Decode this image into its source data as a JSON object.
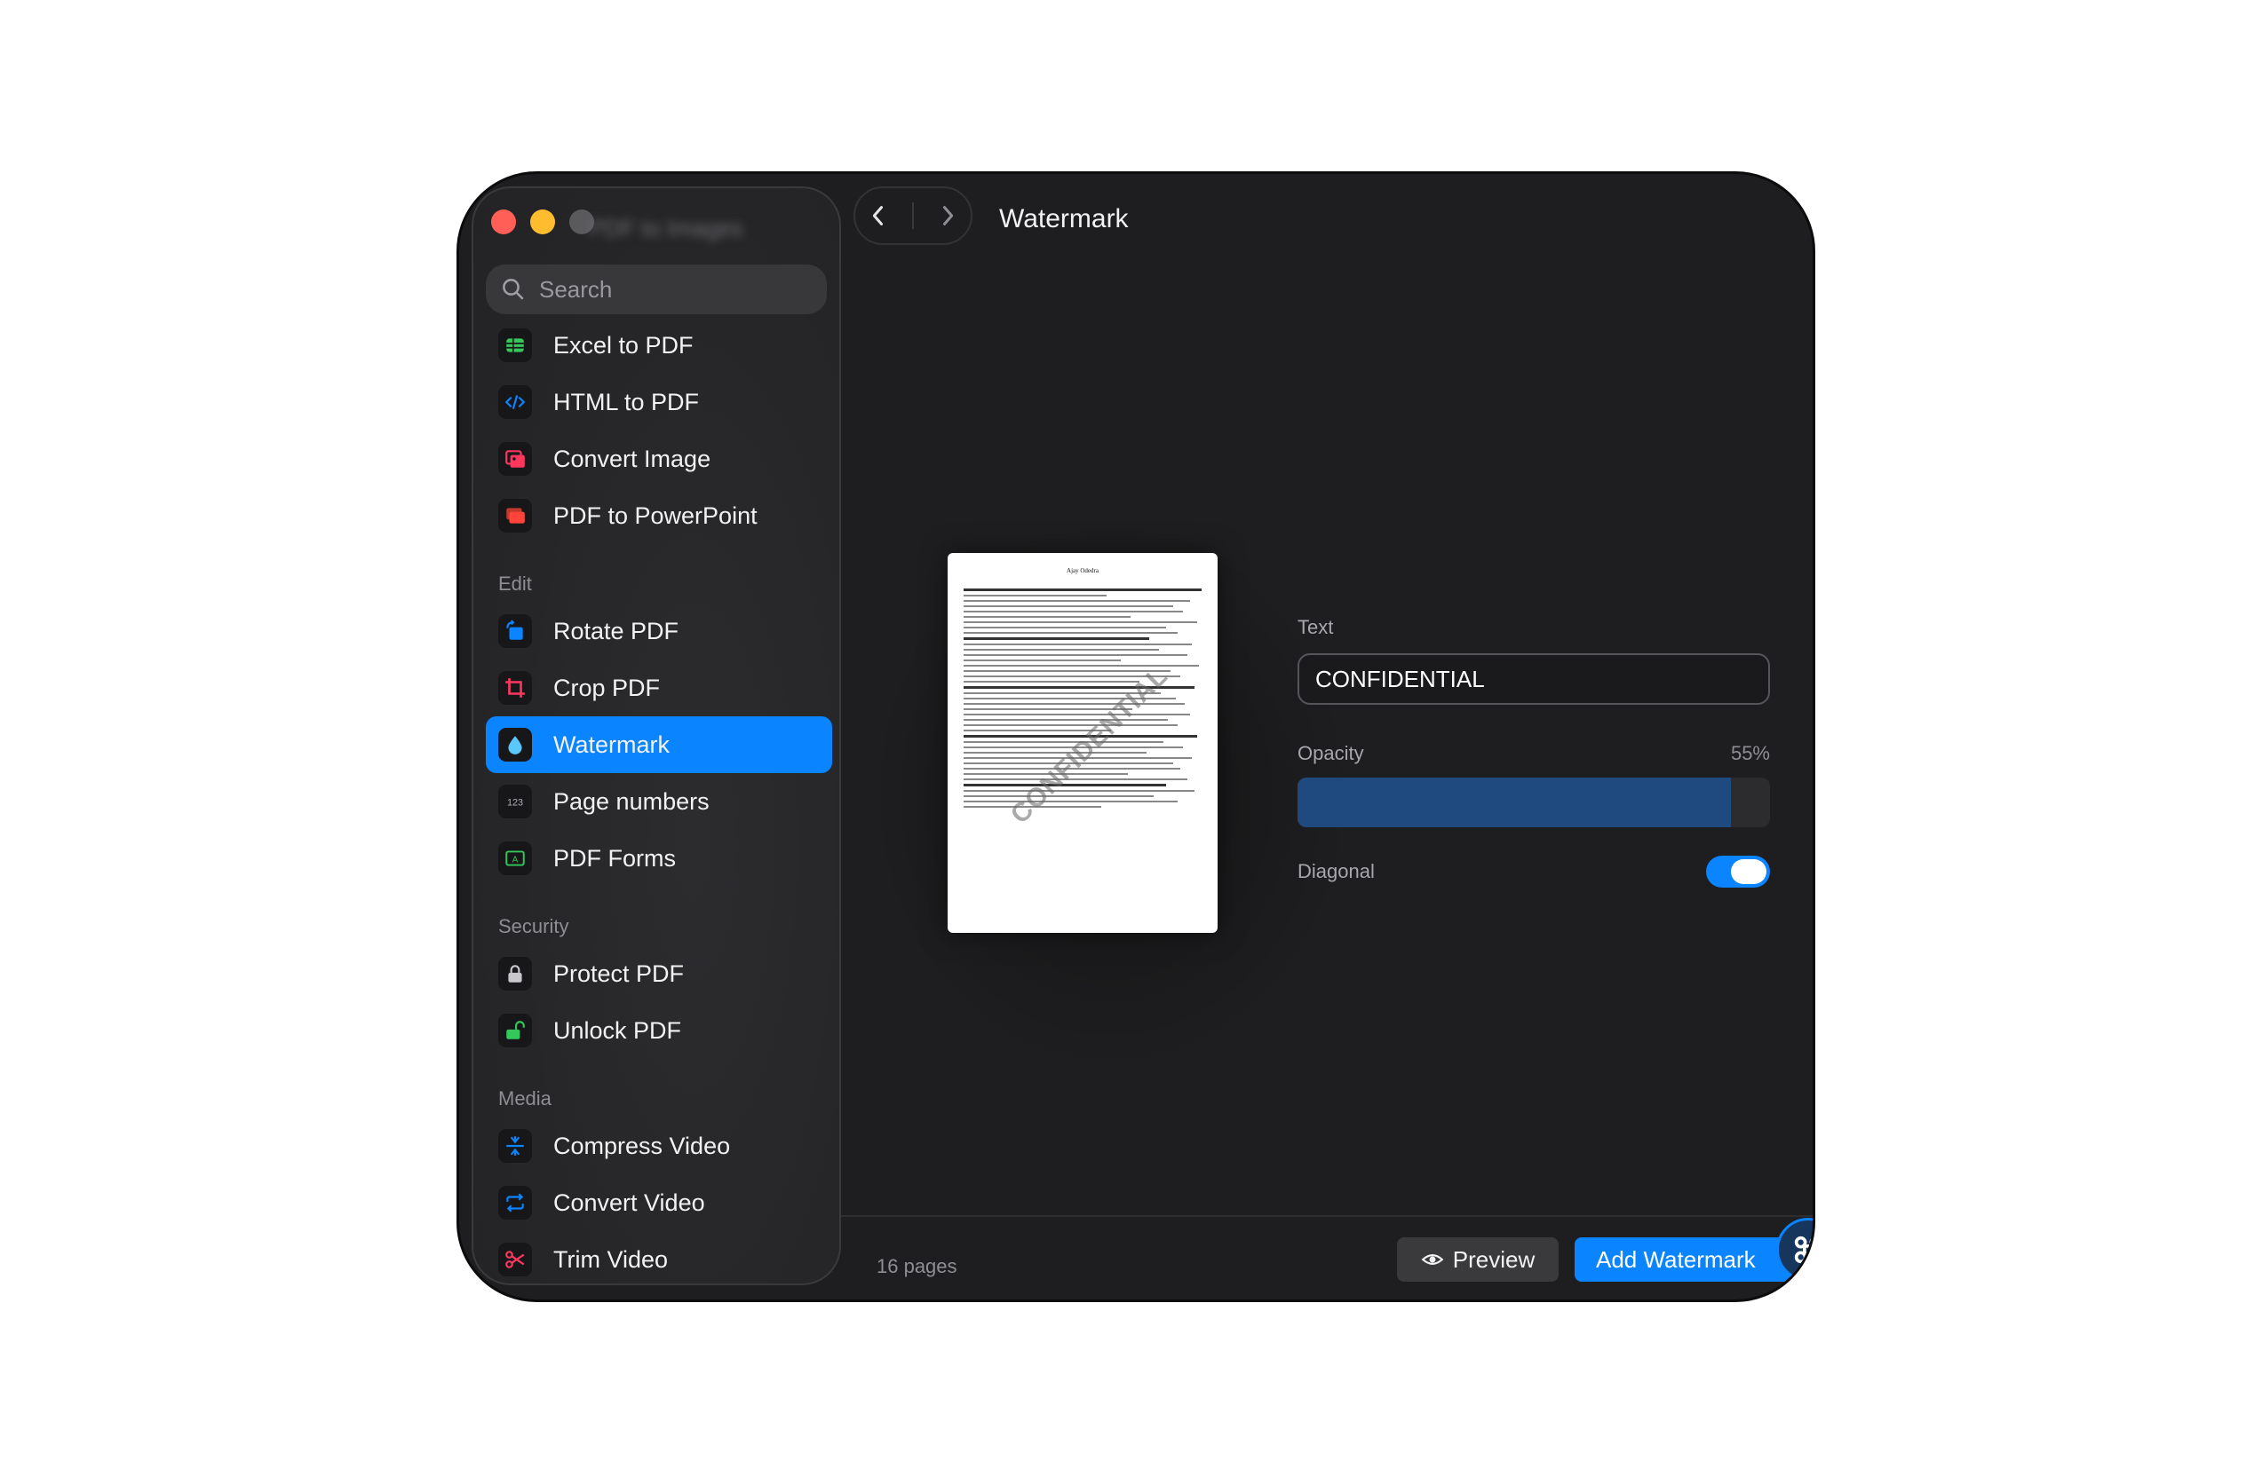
{
  "sidebar": {
    "blurred_title": "PDF to Images",
    "search_placeholder": "Search",
    "convert_items": [
      {
        "label": "Excel to PDF"
      },
      {
        "label": "HTML to PDF"
      },
      {
        "label": "Convert Image"
      },
      {
        "label": "PDF to PowerPoint"
      }
    ],
    "edit": {
      "title": "Edit",
      "items": [
        {
          "label": "Rotate PDF"
        },
        {
          "label": "Crop PDF"
        },
        {
          "label": "Watermark",
          "active": true
        },
        {
          "label": "Page numbers"
        },
        {
          "label": "PDF Forms"
        }
      ]
    },
    "security": {
      "title": "Security",
      "items": [
        {
          "label": "Protect PDF"
        },
        {
          "label": "Unlock PDF"
        }
      ]
    },
    "media": {
      "title": "Media",
      "items": [
        {
          "label": "Compress Video"
        },
        {
          "label": "Convert Video"
        },
        {
          "label": "Trim Video"
        }
      ]
    }
  },
  "main": {
    "title": "Watermark",
    "preview": {
      "document_name": "Ajay Odedra",
      "watermark_text": "CONFIDENTIAL"
    },
    "form": {
      "text_label": "Text",
      "text_value": "CONFIDENTIAL",
      "opacity_label": "Opacity",
      "opacity_value": "55%",
      "opacity_fraction": 0.55,
      "diagonal_label": "Diagonal",
      "diagonal_on": true
    },
    "footer": {
      "pages_count": "16 pages",
      "preview_label": "Preview",
      "add_label": "Add Watermark"
    }
  },
  "colors": {
    "accent": "#0a84ff",
    "window_bg": "#1e1e20",
    "sidebar_bg": "#262628"
  }
}
